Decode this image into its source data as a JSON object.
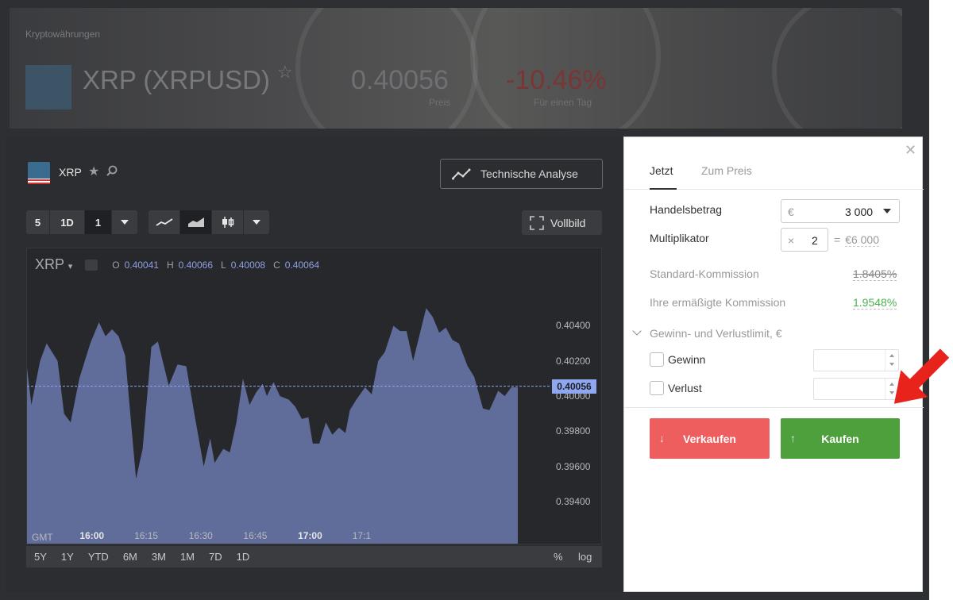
{
  "hero": {
    "category": "Kryptowährungen",
    "title": "XRP (XRPUSD)",
    "price": "0.40056",
    "price_label": "Preis",
    "change": "-10.46%",
    "change_label": "Für einen Tag"
  },
  "chart_header": {
    "symbol": "XRP",
    "technical_analysis_label": "Technische Analyse",
    "fullscreen_label": "Vollbild"
  },
  "toolbar": {
    "interval_items": [
      "5",
      "1D",
      "1"
    ],
    "chart_types": [
      "line-chart-icon",
      "area-chart-icon",
      "candlestick-icon"
    ]
  },
  "legend": {
    "symbol": "XRP",
    "o_label": "O",
    "o_value": "0.40041",
    "h_label": "H",
    "h_value": "0.40066",
    "l_label": "L",
    "l_value": "0.40008",
    "c_label": "C",
    "c_value": "0.40064"
  },
  "price_tag": "0.40056",
  "x_axis": {
    "gmt": "GMT",
    "labels": [
      "16:00",
      "16:15",
      "16:30",
      "16:45",
      "17:00",
      "17:1"
    ]
  },
  "y_axis": {
    "labels": [
      "0.40400",
      "0.40200",
      "0.40000",
      "0.39800",
      "0.39600",
      "0.39400"
    ]
  },
  "ranges": [
    "5Y",
    "1Y",
    "YTD",
    "6M",
    "3M",
    "1M",
    "7D",
    "1D"
  ],
  "range_pct": "%",
  "range_log": "log",
  "chart_data": {
    "type": "area",
    "title": "",
    "xlabel": "",
    "ylabel": "",
    "ylim": [
      0.3926,
      0.4084
    ],
    "x_ticks": [
      "16:00",
      "16:15",
      "16:30",
      "16:45",
      "17:00",
      "17:1"
    ],
    "x_tick_pos": [
      16.0,
      16.25,
      16.5,
      16.75,
      17.0,
      17.25
    ],
    "color": "#6b78ae",
    "series": [
      {
        "values": [
          [
            15.7,
            0.4016
          ],
          [
            15.72,
            0.3995
          ],
          [
            15.76,
            0.402
          ],
          [
            15.79,
            0.403
          ],
          [
            15.84,
            0.402
          ],
          [
            15.87,
            0.399
          ],
          [
            15.9,
            0.3985
          ],
          [
            15.94,
            0.401
          ],
          [
            15.99,
            0.403
          ],
          [
            16.03,
            0.4042
          ],
          [
            16.06,
            0.4034
          ],
          [
            16.09,
            0.4038
          ],
          [
            16.12,
            0.4034
          ],
          [
            16.15,
            0.4023
          ],
          [
            16.2,
            0.3953
          ],
          [
            16.23,
            0.397
          ],
          [
            16.27,
            0.4028
          ],
          [
            16.3,
            0.4031
          ],
          [
            16.35,
            0.4006
          ],
          [
            16.39,
            0.4018
          ],
          [
            16.43,
            0.4017
          ],
          [
            16.47,
            0.3988
          ],
          [
            16.51,
            0.396
          ],
          [
            16.54,
            0.3976
          ],
          [
            16.56,
            0.3962
          ],
          [
            16.6,
            0.397
          ],
          [
            16.63,
            0.3968
          ],
          [
            16.66,
            0.3985
          ],
          [
            16.69,
            0.401
          ],
          [
            16.72,
            0.3995
          ],
          [
            16.75,
            0.4002
          ],
          [
            16.78,
            0.4007
          ],
          [
            16.8,
            0.4
          ],
          [
            16.83,
            0.4008
          ],
          [
            16.86,
            0.4
          ],
          [
            16.9,
            0.3998
          ],
          [
            16.93,
            0.3994
          ],
          [
            16.96,
            0.3987
          ],
          [
            16.99,
            0.3988
          ],
          [
            17.01,
            0.3973
          ],
          [
            17.04,
            0.3973
          ],
          [
            17.07,
            0.3985
          ],
          [
            17.1,
            0.3978
          ],
          [
            17.13,
            0.3982
          ],
          [
            17.16,
            0.3979
          ],
          [
            17.18,
            0.3992
          ],
          [
            17.21,
            0.3998
          ],
          [
            17.25,
            0.4005
          ],
          [
            17.28,
            0.4001
          ],
          [
            17.31,
            0.402
          ],
          [
            17.34,
            0.4025
          ],
          [
            17.38,
            0.404
          ],
          [
            17.41,
            0.4037
          ],
          [
            17.44,
            0.4037
          ],
          [
            17.47,
            0.402
          ],
          [
            17.5,
            0.4035
          ],
          [
            17.53,
            0.405
          ],
          [
            17.56,
            0.4045
          ],
          [
            17.59,
            0.4036
          ],
          [
            17.62,
            0.4039
          ],
          [
            17.65,
            0.4032
          ],
          [
            17.68,
            0.403
          ],
          [
            17.72,
            0.4017
          ],
          [
            17.75,
            0.4011
          ],
          [
            17.79,
            0.3993
          ],
          [
            17.82,
            0.3992
          ],
          [
            17.86,
            0.4003
          ],
          [
            17.89,
            0.4
          ],
          [
            17.92,
            0.4005
          ],
          [
            17.95,
            0.4005
          ]
        ]
      }
    ]
  },
  "trade": {
    "tab_now": "Jetzt",
    "tab_at_price": "Zum Preis",
    "amount_label": "Handelsbetrag",
    "amount_currency": "€",
    "amount_value": "3 000",
    "multiplier_label": "Multiplikator",
    "multiplier_prefix": "×",
    "multiplier_value": "2",
    "multiplier_equals": "=",
    "multiplier_result": "€6 000",
    "standard_commission_label": "Standard-Kommission",
    "standard_commission_value": "1.8405%",
    "reduced_commission_label": "Ihre ermäßigte Kommission",
    "reduced_commission_value": "1.9548%",
    "limits_label": "Gewinn- und Verlustlimit, €",
    "profit_label": "Gewinn",
    "loss_label": "Verlust",
    "sell_label": "Verkaufen",
    "buy_label": "Kaufen"
  },
  "colors": {
    "sell": "#ef5e5e",
    "buy": "#4ea03d",
    "annotation_arrow": "#e8231c",
    "series": "#6b78ae"
  }
}
